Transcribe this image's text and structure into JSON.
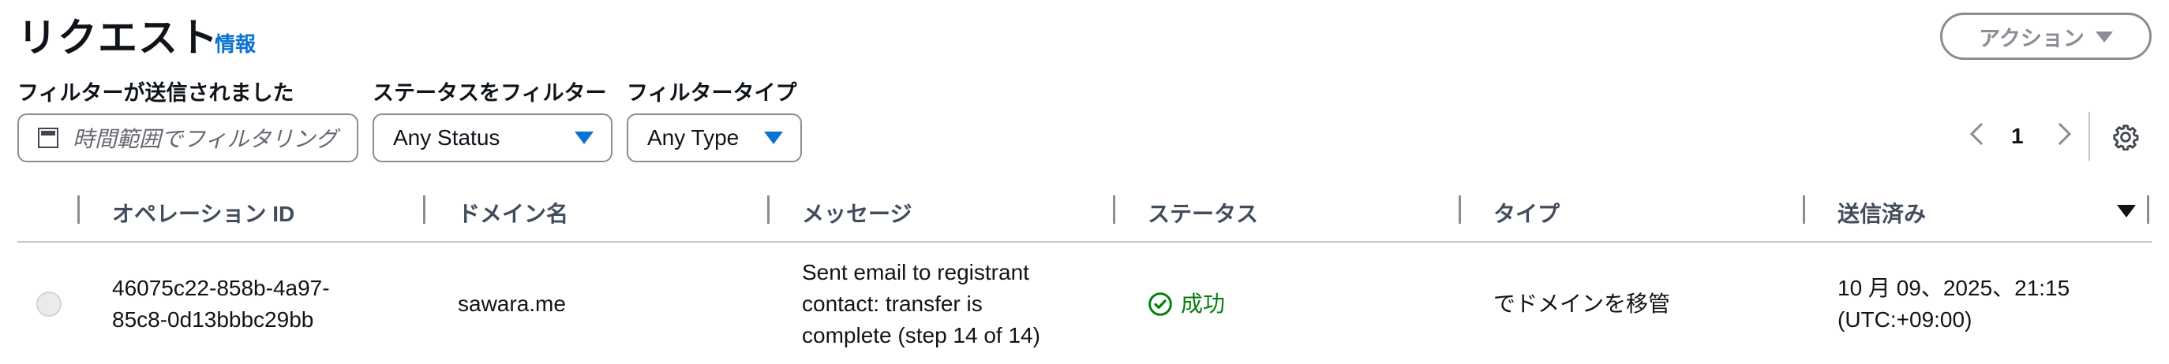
{
  "header": {
    "title": "リクエスト",
    "info_link": "情報",
    "action_button": "アクション"
  },
  "filters": {
    "date_label": "フィルターが送信されました",
    "date_placeholder": "時間範囲でフィルタリング",
    "status_label": "ステータスをフィルター",
    "status_value": "Any Status",
    "type_label": "フィルタータイプ",
    "type_value": "Any Type"
  },
  "pagination": {
    "current_page": "1"
  },
  "table": {
    "columns": [
      "オペレーション ID",
      "ドメイン名",
      "メッセージ",
      "ステータス",
      "タイプ",
      "送信済み"
    ],
    "rows": [
      {
        "operation_id": "46075c22-858b-4a97-85c8-0d13bbbc29bb",
        "operation_id_lines": [
          "46075c22-858b-4a97-",
          "85c8-0d13bbbc29bb"
        ],
        "domain": "sawara.me",
        "message_lines": [
          "Sent email to registrant",
          "contact: transfer is",
          "complete (step 14 of 14)"
        ],
        "status": "成功",
        "type": "でドメインを移管",
        "submitted_lines": [
          "10 月 09、2025、21:15",
          "(UTC:+09:00)"
        ]
      }
    ]
  },
  "colors": {
    "link_blue": "#0972d3",
    "success_green": "#037f0c",
    "disabled_gray": "#8c8c94"
  },
  "icons": [
    "calendar-icon",
    "caret-down-icon",
    "chevron-left-icon",
    "chevron-right-icon",
    "gear-icon",
    "success-check-icon",
    "sort-descending-icon"
  ]
}
